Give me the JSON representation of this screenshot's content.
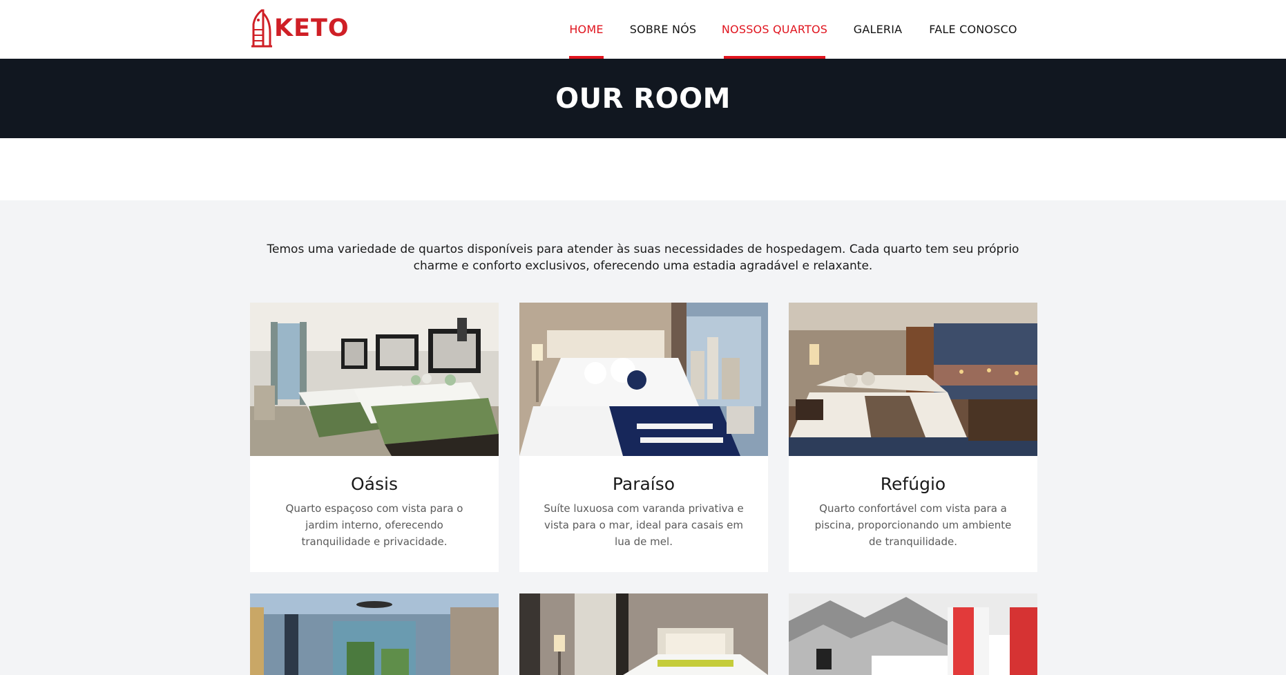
{
  "header": {
    "logo_text": "KETO",
    "nav": [
      {
        "label": "HOME"
      },
      {
        "label": "SOBRE NÓS"
      },
      {
        "label": "NOSSOS QUARTOS"
      },
      {
        "label": "GALERIA"
      },
      {
        "label": "FALE CONOSCO"
      }
    ],
    "active_items": [
      "HOME",
      "NOSSOS QUARTOS"
    ]
  },
  "banner": {
    "title": "OUR ROOM"
  },
  "intro": {
    "text": "Temos uma variedade de quartos disponíveis para atender às suas necessidades de hospedagem. Cada quarto tem seu próprio charme e conforto exclusivos, oferecendo uma estadia agradável e relaxante."
  },
  "rooms": [
    {
      "name": "Oásis",
      "description": "Quarto espaçoso com vista para o jardim interno, oferecendo tranquilidade e privacidade."
    },
    {
      "name": "Paraíso",
      "description": "Suíte luxuosa com varanda privativa e vista para o mar, ideal para casais em lua de mel."
    },
    {
      "name": "Refúgio",
      "description": "Quarto confortável com vista para a piscina, proporcionando um ambiente de tranquilidade."
    },
    {
      "name": "",
      "description": ""
    },
    {
      "name": "",
      "description": ""
    },
    {
      "name": "",
      "description": ""
    }
  ],
  "colors": {
    "brand_red": "#e0141e",
    "banner_bg": "#111720",
    "page_bg": "#f3f4f6"
  }
}
